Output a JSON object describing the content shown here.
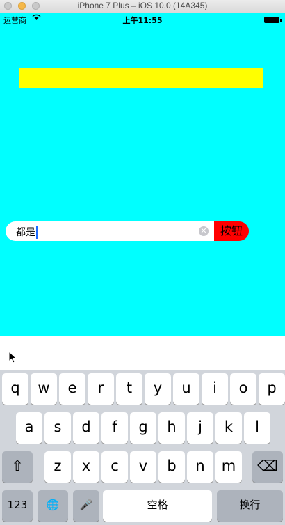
{
  "window": {
    "title": "iPhone 7 Plus – iOS 10.0 (14A345)"
  },
  "statusbar": {
    "carrier": "运营商",
    "wifi_icon": "wifi-icon",
    "time": "上午11:55",
    "battery_icon": "battery-icon"
  },
  "colors": {
    "background": "#00ffff",
    "banner": "#ffff00",
    "button": "#ff0000"
  },
  "textfield": {
    "value": "都是",
    "clear_icon": "⊗"
  },
  "button": {
    "label": "按钮"
  },
  "keyboard": {
    "row1": [
      "q",
      "w",
      "e",
      "r",
      "t",
      "y",
      "u",
      "i",
      "o",
      "p"
    ],
    "row2": [
      "a",
      "s",
      "d",
      "f",
      "g",
      "h",
      "j",
      "k",
      "l"
    ],
    "row3": [
      "z",
      "x",
      "c",
      "v",
      "b",
      "n",
      "m"
    ],
    "shift_icon": "⇧",
    "delete_icon": "⌫",
    "numbers_label": "123",
    "globe_icon": "🌐",
    "mic_icon": "🎤",
    "space_label": "空格",
    "return_label": "换行"
  }
}
